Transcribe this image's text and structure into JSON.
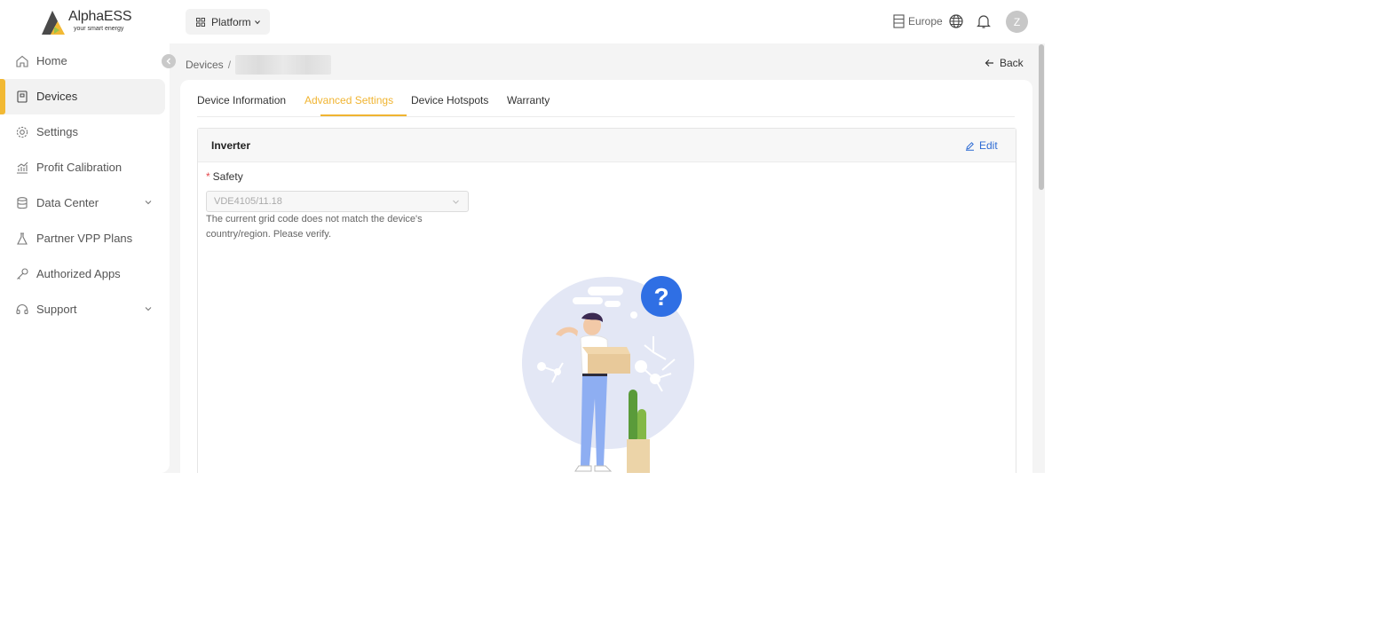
{
  "brand": {
    "name": "AlphaESS",
    "tagline": "your smart energy"
  },
  "sidebar": {
    "items": [
      {
        "label": "Home",
        "icon": "home-icon"
      },
      {
        "label": "Devices",
        "icon": "device-icon",
        "active": true
      },
      {
        "label": "Settings",
        "icon": "gear-icon"
      },
      {
        "label": "Profit Calibration",
        "icon": "chart-icon"
      },
      {
        "label": "Data Center",
        "icon": "database-icon",
        "expandable": true
      },
      {
        "label": "Partner VPP Plans",
        "icon": "flask-icon"
      },
      {
        "label": "Authorized Apps",
        "icon": "key-icon"
      },
      {
        "label": "Support",
        "icon": "headset-icon",
        "expandable": true
      }
    ]
  },
  "header": {
    "platform_label": "Platform",
    "region_label": "Europe",
    "avatar_initial": "Z"
  },
  "breadcrumb": {
    "root": "Devices",
    "separator": "/"
  },
  "back_label": "Back",
  "tabs": [
    {
      "label": "Device Information"
    },
    {
      "label": "Advanced Settings",
      "active": true
    },
    {
      "label": "Device Hotspots"
    },
    {
      "label": "Warranty"
    }
  ],
  "panel": {
    "title": "Inverter",
    "edit_label": "Edit",
    "field": {
      "required_mark": "*",
      "label": "Safety",
      "value": "VDE4105/11.18",
      "hint": "The current grid code does not match the device's country/region. Please verify."
    }
  },
  "illustration": {
    "badge": "?"
  },
  "colors": {
    "accent": "#f0b431",
    "link": "#2d6bd4",
    "illustration_circle": "#e3e7f5",
    "badge": "#2f6fe4"
  }
}
